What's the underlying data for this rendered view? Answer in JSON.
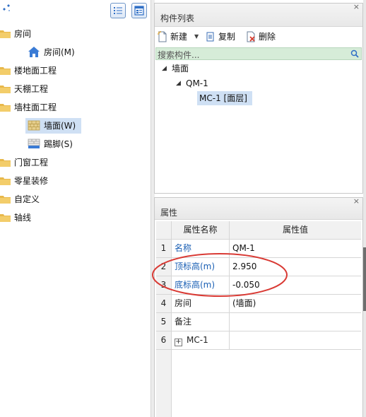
{
  "left_tree": {
    "items": [
      {
        "label": "房间",
        "children": [
          {
            "label": "房间(M)",
            "icon": "house-icon"
          }
        ]
      },
      {
        "label": "楼地面工程",
        "children": []
      },
      {
        "label": "天棚工程",
        "children": []
      },
      {
        "label": "墙柱面工程",
        "children": [
          {
            "label": "墙面(W)",
            "icon": "wall-brick-icon",
            "selected": true
          },
          {
            "label": "踢脚(S)",
            "icon": "skirting-icon"
          }
        ]
      },
      {
        "label": "门窗工程",
        "children": []
      },
      {
        "label": "零星装修",
        "children": []
      },
      {
        "label": "自定义",
        "children": []
      },
      {
        "label": "轴线",
        "children": []
      }
    ]
  },
  "component_list": {
    "title": "构件列表",
    "toolbar": {
      "new_label": "新建",
      "copy_label": "复制",
      "delete_label": "删除"
    },
    "search_placeholder": "搜索构件...",
    "tree": {
      "root": "墙面",
      "child": "QM-1",
      "grandchild": "MC-1 [面层]"
    }
  },
  "properties": {
    "title": "属性",
    "headers": {
      "name": "属性名称",
      "value": "属性值"
    },
    "rows": [
      {
        "num": "1",
        "name": "名称",
        "value": "QM-1",
        "name_color": "#1a5fb4"
      },
      {
        "num": "2",
        "name": "顶标高(m)",
        "value": "2.950",
        "name_color": "#1a5fb4"
      },
      {
        "num": "3",
        "name": "底标高(m)",
        "value": "-0.050",
        "name_color": "#1a5fb4"
      },
      {
        "num": "4",
        "name": "房间",
        "value": "(墙面)",
        "name_color": "#222222"
      },
      {
        "num": "5",
        "name": "备注",
        "value": "",
        "name_color": "#222222"
      },
      {
        "num": "6",
        "name": "MC-1",
        "value": "",
        "name_color": "#222222",
        "expandable": true
      }
    ]
  },
  "colors": {
    "accent_blue": "#1a5fb4",
    "annotation_red": "#d93a34",
    "selection": "#cfe0f4",
    "search_bg": "#d6ecd8"
  }
}
